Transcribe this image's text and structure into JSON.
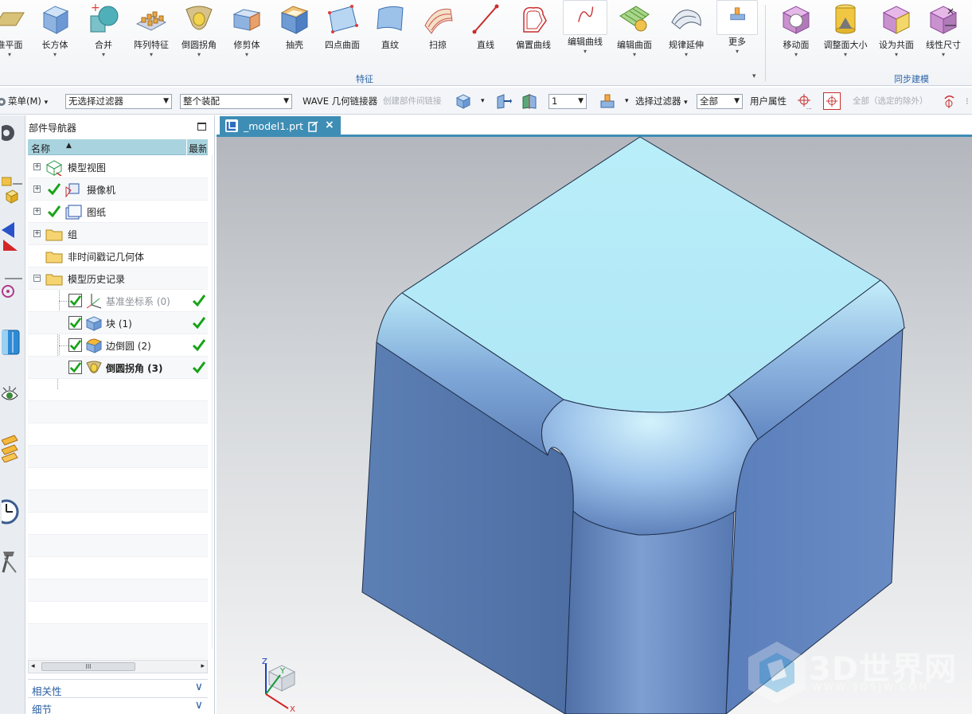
{
  "ribbon": {
    "buttons": [
      {
        "label": "准平面"
      },
      {
        "label": "长方体"
      },
      {
        "label": "合并"
      },
      {
        "label": "阵列特征"
      },
      {
        "label": "倒圆拐角"
      },
      {
        "label": "修剪体"
      },
      {
        "label": "抽壳"
      },
      {
        "label": "四点曲面"
      },
      {
        "label": "直纹"
      },
      {
        "label": "扫掠"
      },
      {
        "label": "直线"
      },
      {
        "label": "偏置曲线"
      },
      {
        "label": "编辑曲线"
      },
      {
        "label": "编辑曲面"
      },
      {
        "label": "规律延伸"
      },
      {
        "label": "更多"
      },
      {
        "label": "移动面"
      },
      {
        "label": "调整面大小"
      },
      {
        "label": "设为共面"
      },
      {
        "label": "线性尺寸"
      }
    ],
    "groups": {
      "features": "特征",
      "sync": "同步建模"
    }
  },
  "toolbar2": {
    "menu": "菜单(M)",
    "type_filter": "无选择过滤器",
    "scope": "整个装配",
    "wave": "WAVE 几何链接器",
    "create_link": "创建部件间链接",
    "level": "1",
    "select_filter": "选择过滤器",
    "all": "全部",
    "user_attr": "用户属性",
    "all_except": "全部（选定的除外）"
  },
  "navigator": {
    "title": "部件导航器",
    "col_name": "名称",
    "col_latest": "最新",
    "rows": [
      {
        "label": "模型视图"
      },
      {
        "label": "摄像机"
      },
      {
        "label": "图纸"
      },
      {
        "label": "组"
      },
      {
        "label": "非时间戳记几何体"
      },
      {
        "label": "模型历史记录"
      },
      {
        "label": "基准坐标系 (0)"
      },
      {
        "label": "块 (1)"
      },
      {
        "label": "边倒圆 (2)"
      },
      {
        "label": "倒圆拐角 (3)"
      }
    ],
    "scroll_thumb": "III",
    "panels": {
      "dependencies": "相关性",
      "details": "细节"
    }
  },
  "tab": {
    "name": "_model1.prt",
    "close": "×"
  },
  "triad": {
    "z": "Z",
    "y": "Y",
    "x": "X"
  },
  "watermark": {
    "text": "3D世界网",
    "sub": "WWW.3DSJW.COM"
  },
  "colors": {
    "accent": "#3e8db5",
    "top_face": "#b8ecf8",
    "side_face": "#5b7fb9",
    "check": "#17a317"
  }
}
